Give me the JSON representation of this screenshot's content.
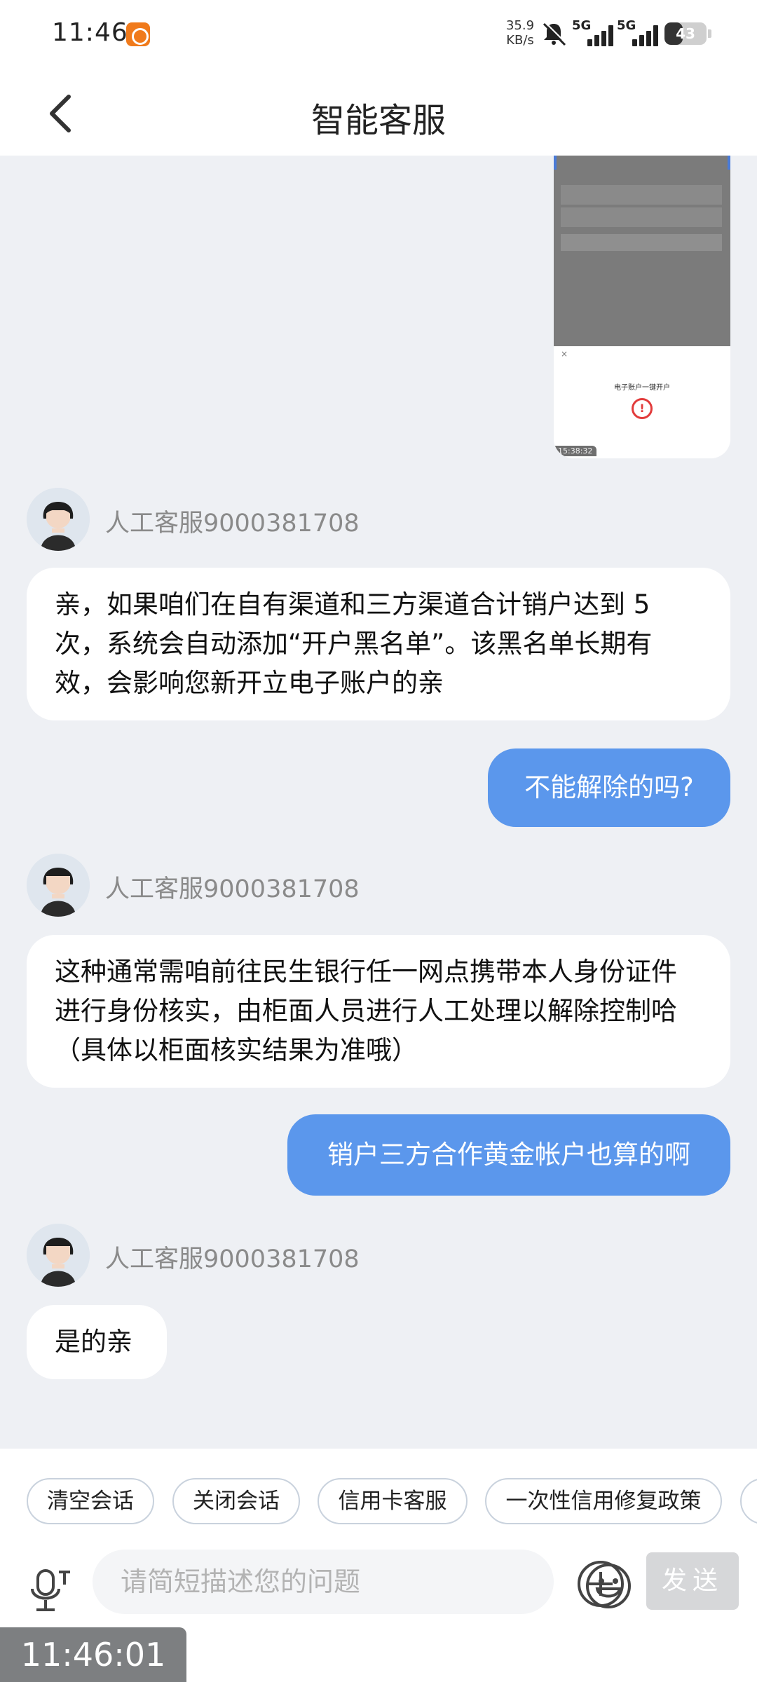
{
  "status_bar": {
    "time": "11:46",
    "net_speed_value": "35.9",
    "net_speed_unit": "KB/s",
    "signal_1": "5G",
    "signal_2": "5G",
    "battery": "43",
    "battery_level": 0.43
  },
  "header": {
    "title": "智能客服"
  },
  "messages": {
    "m1_sender": "人工客服9000381708",
    "m1_text": "亲，如果咱们在自有渠道和三方渠道合计销户达到 5 次，系统会自动添加“开户黑名单”。该黑名单长期有效，会影响您新开立电子账户的亲",
    "m2_text": "不能解除的吗?",
    "m3_sender": "人工客服9000381708",
    "m3_text": "这种通常需咱前往民生银行任一网点携带本人身份证件进行身份核实，由柜面人员进行人工处理以解除控制哈（具体以柜面核实结果为准哦）",
    "m4_text": "销户三方合作黄金帐户也算的啊",
    "m5_sender": "人工客服9000381708",
    "m5_text": "是的亲"
  },
  "attachment": {
    "popup_title": "电子账户一键开户",
    "timestamp": "15:38:32"
  },
  "quick_actions": {
    "clear": "清空会话",
    "close": "关闭会话",
    "credit_card": "信用卡客服",
    "repair_policy": "一次性信用修复政策"
  },
  "input": {
    "placeholder": "请简短描述您的问题",
    "send_label": "发送"
  },
  "overlay": {
    "clock": "11:46:01"
  },
  "colors": {
    "accent": "#5b97ec",
    "background": "#eef0f4",
    "alert": "#e23b3b"
  }
}
